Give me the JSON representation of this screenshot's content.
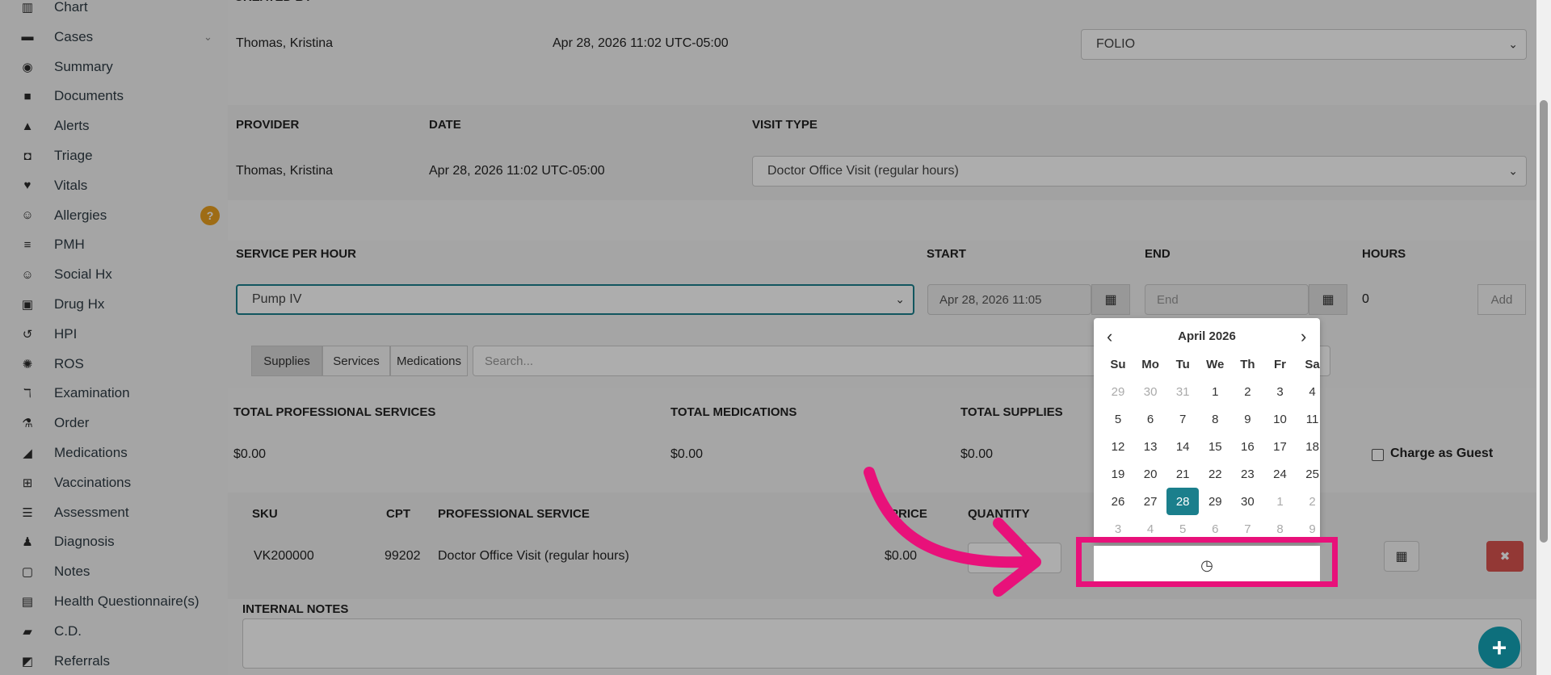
{
  "sidebar": {
    "items": [
      {
        "label": "Chart",
        "icon": "bar-chart-icon",
        "glyph": "▥"
      },
      {
        "label": "Cases",
        "icon": "folder-open-icon",
        "glyph": "▬"
      },
      {
        "label": "Summary",
        "icon": "eye-icon",
        "glyph": "◉"
      },
      {
        "label": "Documents",
        "icon": "folder-icon",
        "glyph": "■"
      },
      {
        "label": "Alerts",
        "icon": "warning-icon",
        "glyph": "▲"
      },
      {
        "label": "Triage",
        "icon": "inbox-icon",
        "glyph": "◘"
      },
      {
        "label": "Vitals",
        "icon": "heart-icon",
        "glyph": "♥"
      },
      {
        "label": "Allergies",
        "icon": "smile-icon",
        "glyph": "☺"
      },
      {
        "label": "PMH",
        "icon": "sort-icon",
        "glyph": "≡"
      },
      {
        "label": "Social Hx",
        "icon": "smile-icon",
        "glyph": "☺"
      },
      {
        "label": "Drug Hx",
        "icon": "medkit-icon",
        "glyph": "▣"
      },
      {
        "label": "HPI",
        "icon": "history-icon",
        "glyph": "↺"
      },
      {
        "label": "ROS",
        "icon": "gear-icon",
        "glyph": "✺"
      },
      {
        "label": "Examination",
        "icon": "stethoscope-icon",
        "glyph": "ℸ"
      },
      {
        "label": "Order",
        "icon": "flask-icon",
        "glyph": "⚗"
      },
      {
        "label": "Medications",
        "icon": "pill-icon",
        "glyph": "◢"
      },
      {
        "label": "Vaccinations",
        "icon": "plus-square-icon",
        "glyph": "⊞"
      },
      {
        "label": "Assessment",
        "icon": "list-icon",
        "glyph": "☰"
      },
      {
        "label": "Diagnosis",
        "icon": "user-doctor-icon",
        "glyph": "♟"
      },
      {
        "label": "Notes",
        "icon": "file-icon",
        "glyph": "▢"
      },
      {
        "label": "Health Questionnaire(s)",
        "icon": "clipboard-icon",
        "glyph": "▤"
      },
      {
        "label": "C.D.",
        "icon": "ambulance-icon",
        "glyph": "▰"
      },
      {
        "label": "Referrals",
        "icon": "share-square-icon",
        "glyph": "◩"
      }
    ],
    "cases_chevron": "⌄",
    "allergies_help": "?"
  },
  "encounter": {
    "created_by_value": "Thomas, Kristina",
    "created_date_value": "Apr 28, 2026 11:02 UTC-05:00",
    "type_value": "FOLIO"
  },
  "visit": {
    "provider_header": "PROVIDER",
    "date_header": "DATE",
    "visit_type_header": "VISIT TYPE",
    "provider_value": "Thomas, Kristina",
    "date_value": "Apr 28, 2026 11:02 UTC-05:00",
    "visit_type_value": "Doctor Office Visit (regular hours)"
  },
  "service": {
    "service_header": "SERVICE PER HOUR",
    "start_header": "START",
    "end_header": "END",
    "hours_header": "HOURS",
    "service_value": "Pump IV",
    "start_value": "Apr 28, 2026 11:05",
    "end_placeholder": "End",
    "hours_value": "0",
    "add_label": "Add"
  },
  "tabs": {
    "supplies": "Supplies",
    "services": "Services",
    "medications": "Medications",
    "search_placeholder": "Search..."
  },
  "totals": {
    "prof_header": "TOTAL PROFESSIONAL SERVICES",
    "med_header": "TOTAL MEDICATIONS",
    "sup_header": "TOTAL SUPPLIES",
    "prof_value": "$0.00",
    "med_value": "$0.00",
    "sup_value": "$0.00",
    "charge_guest": "Charge as Guest"
  },
  "table": {
    "headers": {
      "sku": "SKU",
      "cpt": "CPT",
      "service": "PROFESSIONAL SERVICE",
      "price": "PRICE",
      "quantity": "QUANTITY"
    },
    "row": {
      "sku": "VK200000",
      "cpt": "99202",
      "service": "Doctor Office Visit (regular hours)",
      "price": "$0.00"
    },
    "delete_glyph": "✖",
    "gift_glyph": "🎁"
  },
  "notes": {
    "header": "INTERNAL NOTES"
  },
  "datepicker": {
    "title": "April 2026",
    "prev": "‹",
    "next": "›",
    "dow": [
      "Su",
      "Mo",
      "Tu",
      "We",
      "Th",
      "Fr",
      "Sa"
    ],
    "weeks": [
      [
        "29",
        "30",
        "31",
        "1",
        "2",
        "3",
        "4"
      ],
      [
        "5",
        "6",
        "7",
        "8",
        "9",
        "10",
        "11"
      ],
      [
        "12",
        "13",
        "14",
        "15",
        "16",
        "17",
        "18"
      ],
      [
        "19",
        "20",
        "21",
        "22",
        "23",
        "24",
        "25"
      ],
      [
        "26",
        "27",
        "28",
        "29",
        "30",
        "1",
        "2"
      ],
      [
        "3",
        "4",
        "5",
        "6",
        "7",
        "8",
        "9"
      ]
    ],
    "selected": "28",
    "time_glyph": "◷"
  },
  "fab": "+",
  "colors": {
    "accent": "#1b7f8c",
    "highlight": "#e8117a",
    "fab": "#0d6f7c",
    "delete": "#d9534f"
  }
}
